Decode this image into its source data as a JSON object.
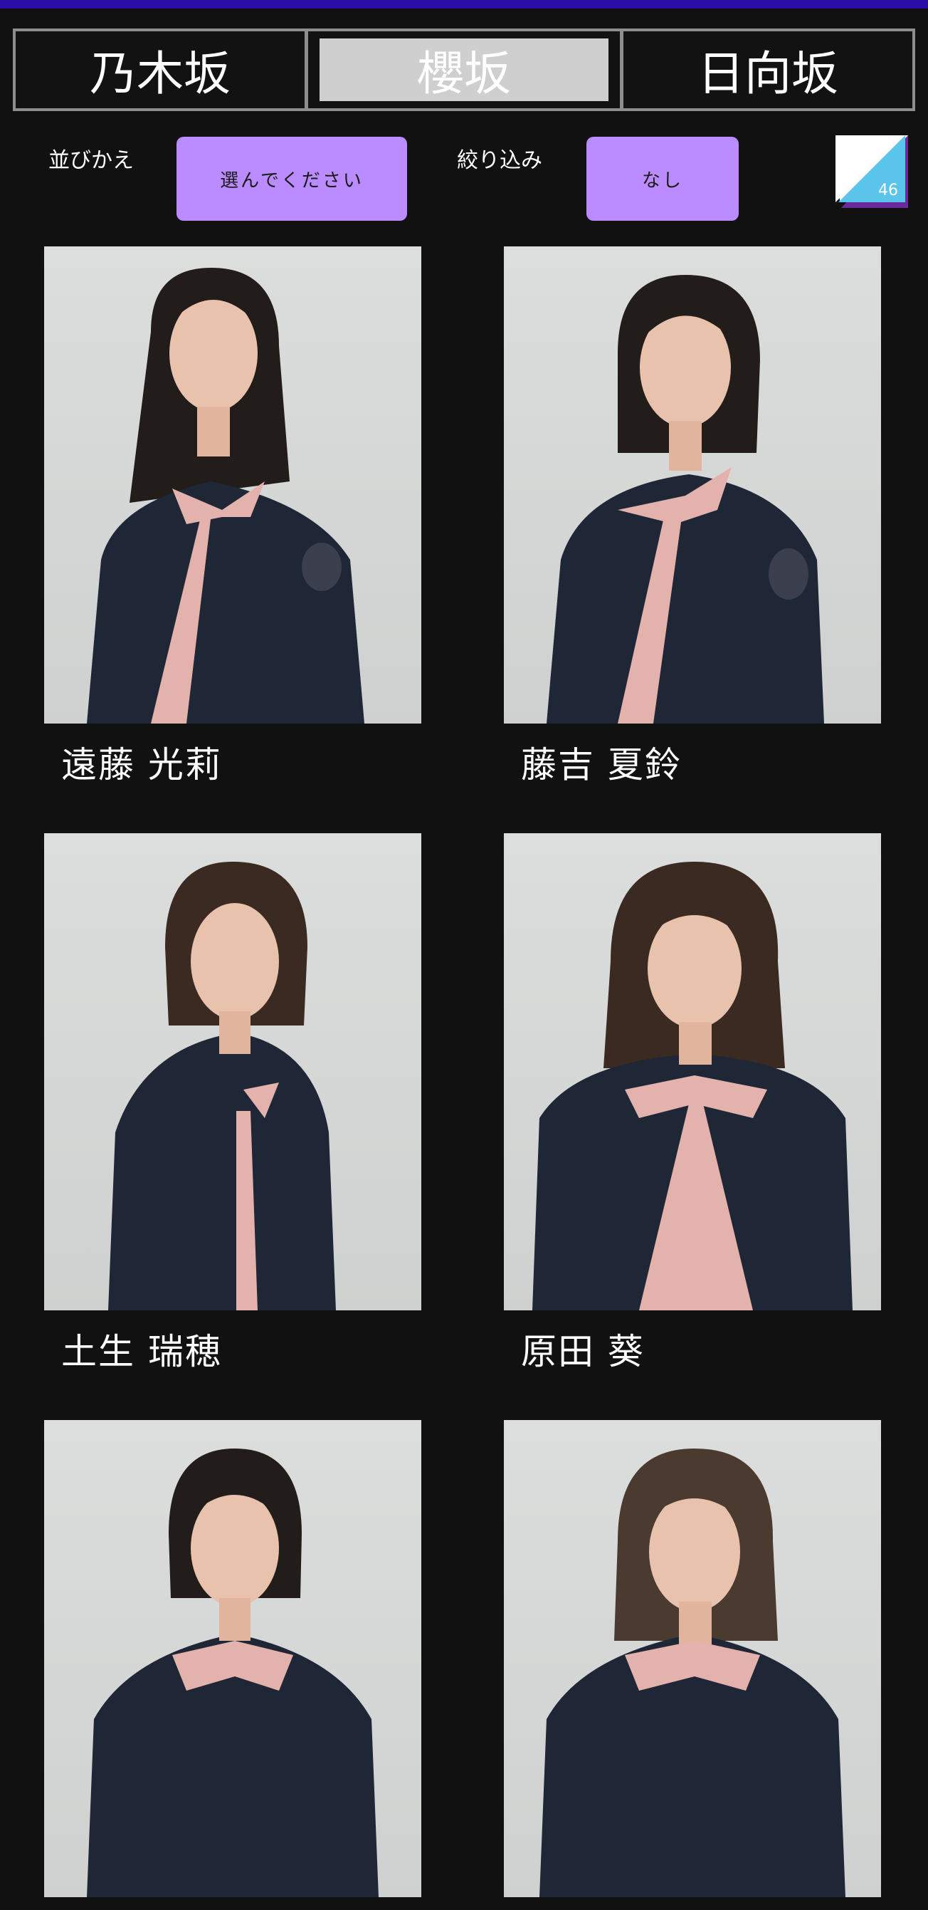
{
  "tabs": [
    {
      "label": "乃木坂",
      "active": false
    },
    {
      "label": "櫻坂",
      "active": true
    },
    {
      "label": "日向坂",
      "active": false
    }
  ],
  "controls": {
    "sort_label": "並びかえ",
    "sort_value": "選んでください",
    "filter_label": "絞り込み",
    "filter_value": "なし",
    "logo_text": "46"
  },
  "members": [
    {
      "name": "遠藤 光莉",
      "hair": "long"
    },
    {
      "name": "藤吉 夏鈴",
      "hair": "short"
    },
    {
      "name": "土生 瑞穂",
      "hair": "short"
    },
    {
      "name": "原田 葵",
      "hair": "medium"
    },
    {
      "name": "",
      "hair": "bob"
    },
    {
      "name": "",
      "hair": "medium"
    }
  ],
  "colors": {
    "accent_bar": "#2a0ea8",
    "button": "#bb8cff",
    "jacket": "#1f2636",
    "bow": "#e3b2ad",
    "hair": "#221c1a",
    "skin": "#e8c2ac"
  }
}
